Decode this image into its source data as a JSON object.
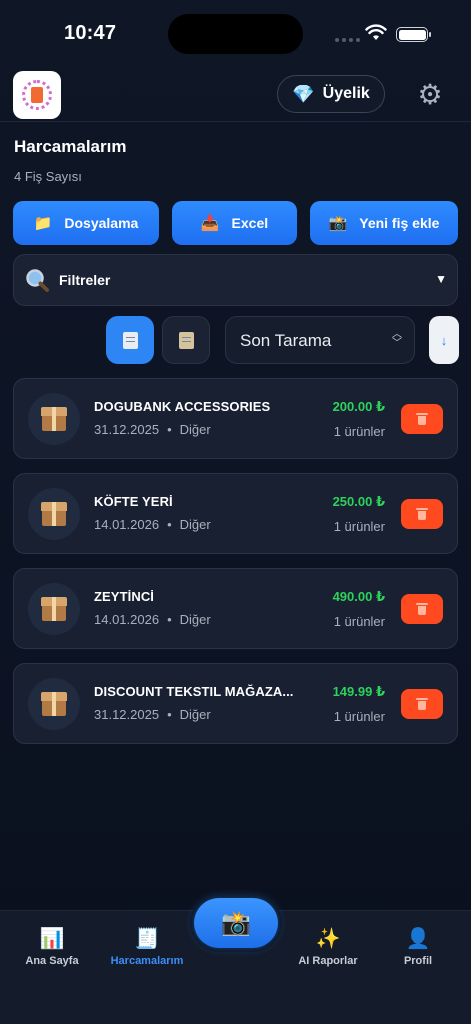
{
  "status_bar": {
    "time": "10:47"
  },
  "header": {
    "membership_label": "Üyelik",
    "membership_icon": "gem-icon",
    "settings_icon": "gear-icon"
  },
  "page": {
    "title": "Harcamalarım",
    "receipt_count": "4 Fiş Sayısı"
  },
  "actions": {
    "filing_label": "Dosyalama",
    "excel_label": "Excel",
    "add_receipt_label": "Yeni fiş ekle"
  },
  "filters": {
    "label": "Filtreler",
    "caret": "▼"
  },
  "sort": {
    "selected": "Son Tarama",
    "order_symbol": "↓"
  },
  "receipts": [
    {
      "store": "DOGUBANK ACCESSORIES",
      "date": "31.12.2025",
      "category": "Diğer",
      "amount": "200.00 ₺",
      "items": "1 ürünler"
    },
    {
      "store": "KÖFTE YERİ",
      "date": "14.01.2026",
      "category": "Diğer",
      "amount": "250.00 ₺",
      "items": "1 ürünler"
    },
    {
      "store": "ZEYTİNCİ",
      "date": "14.01.2026",
      "category": "Diğer",
      "amount": "490.00 ₺",
      "items": "1 ürünler"
    },
    {
      "store": "DISCOUNT TEKSTIL MAĞAZA...",
      "date": "31.12.2025",
      "category": "Diğer",
      "amount": "149.99 ₺",
      "items": "1 ürünler"
    }
  ],
  "tabs": {
    "home": "Ana Sayfa",
    "expenses": "Harcamalarım",
    "ai_reports": "AI Raporlar",
    "profile": "Profil"
  },
  "colors": {
    "accent": "#2e86f5",
    "amount_green": "#2ed15c",
    "delete_red": "#ff4a1f",
    "background": "#0f1626"
  }
}
